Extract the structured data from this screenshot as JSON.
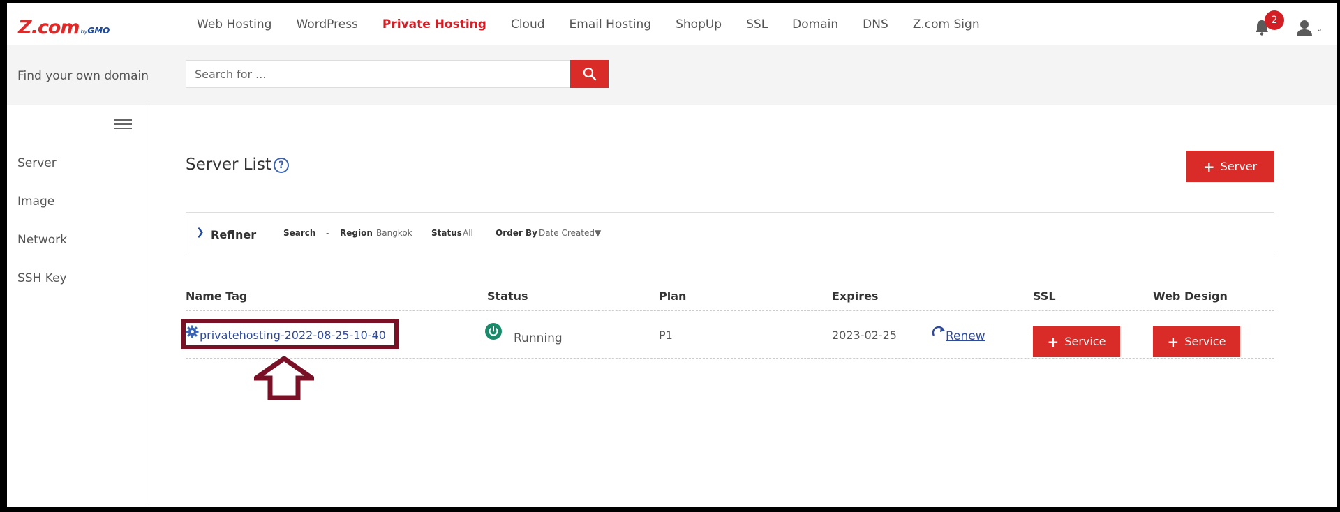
{
  "brand": {
    "logo_main": "Z.com",
    "logo_by": "by",
    "logo_gmo": "GMO"
  },
  "nav": {
    "items": [
      {
        "label": "Web Hosting",
        "active": false
      },
      {
        "label": "WordPress",
        "active": false
      },
      {
        "label": "Private Hosting",
        "active": true
      },
      {
        "label": "Cloud",
        "active": false
      },
      {
        "label": "Email Hosting",
        "active": false
      },
      {
        "label": "ShopUp",
        "active": false
      },
      {
        "label": "SSL",
        "active": false
      },
      {
        "label": "Domain",
        "active": false
      },
      {
        "label": "DNS",
        "active": false
      },
      {
        "label": "Z.com Sign",
        "active": false
      }
    ],
    "notification_count": "2",
    "icons": {
      "notifications": "bell-icon",
      "account": "user-icon",
      "account_menu": "chevron-down-icon"
    }
  },
  "domain_search": {
    "label": "Find your own domain",
    "placeholder": "Search for ...",
    "value": "",
    "button_icon": "search-icon"
  },
  "sidebar": {
    "menu_icon": "hamburger-icon",
    "items": [
      {
        "label": "Server"
      },
      {
        "label": "Image"
      },
      {
        "label": "Network"
      },
      {
        "label": "SSH Key"
      }
    ]
  },
  "main": {
    "title": "Server List",
    "help": "?",
    "add_button": {
      "icon": "+",
      "label": "Server"
    },
    "refiner": {
      "label": "Refiner",
      "expand_icon": "❯",
      "filters": [
        {
          "key": "Search",
          "value": "-"
        },
        {
          "key": "Region",
          "value": "Bangkok"
        },
        {
          "key": "Status",
          "value": "All"
        },
        {
          "key": "Order By",
          "value": "Date Created▼"
        }
      ]
    },
    "table": {
      "columns": [
        "Name Tag",
        "Status",
        "Plan",
        "Expires",
        "SSL",
        "Web Design"
      ],
      "rows": [
        {
          "name_tag": "privatehosting-2022-08-25-10-40",
          "status": "Running",
          "plan": "P1",
          "expires": "2023-02-25",
          "renew_label": "Renew",
          "ssl_button": {
            "icon": "+",
            "label": "Service"
          },
          "web_design_button": {
            "icon": "+",
            "label": "Service"
          }
        }
      ]
    }
  },
  "annotations": {
    "highlight_color": "#7a1026"
  },
  "colors": {
    "accent_red": "#d92b27",
    "link_blue": "#2e4a99",
    "running_green": "#1b8a6b"
  }
}
